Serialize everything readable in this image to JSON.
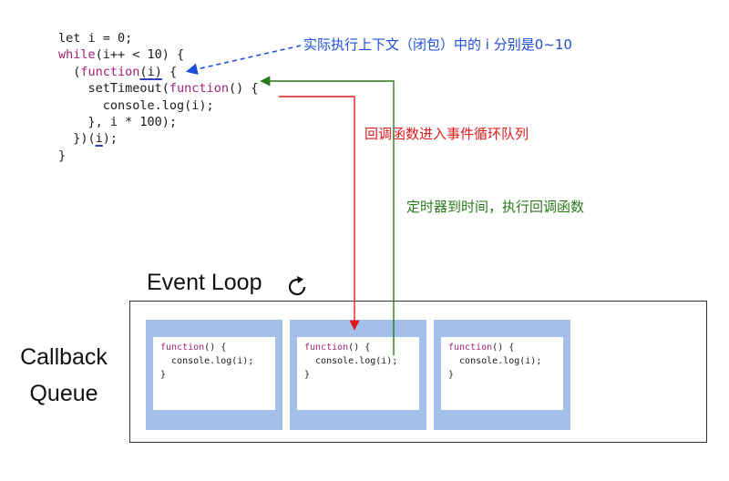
{
  "code": {
    "line1": "let i = 0;",
    "line2_kw": "while",
    "line2_rest": "(i++ < 10) {",
    "line3_open": "  (",
    "line3_kw": "function",
    "line3_param_open": "(",
    "line3_param": "i",
    "line3_param_close": ")",
    "line3_rest": " {",
    "line4_pre": "    setTimeout(",
    "line4_kw": "function",
    "line4_rest": "() {",
    "line5": "      console.log(i);",
    "line6": "    }, i * 100);",
    "line7_pre": "  })(",
    "line7_arg": "i",
    "line7_rest": ");",
    "line8": "}"
  },
  "annotations": {
    "blue": "实际执行上下文（闭包）中的 i 分别是0~10",
    "red": "回调函数进入事件循环队列",
    "green": "定时器到时间，执行回调函数"
  },
  "event_loop_title": "Event Loop",
  "callback_queue_label_1": "Callback",
  "callback_queue_label_2": "Queue",
  "callbacks": [
    {
      "kw": "function",
      "sig": "() {",
      "body": "  console.log(i);",
      "close": "}"
    },
    {
      "kw": "function",
      "sig": "() {",
      "body": "  console.log(i);",
      "close": "}"
    },
    {
      "kw": "function",
      "sig": "() {",
      "body": "  console.log(i);",
      "close": "}"
    }
  ],
  "colors": {
    "blue": "#1e4fd8",
    "red": "#e01a1a",
    "green": "#2a7a1a",
    "queue_fill": "#a4bfe8",
    "keyword": "#a0207a"
  },
  "icons": {
    "event_loop": "refresh-icon"
  }
}
